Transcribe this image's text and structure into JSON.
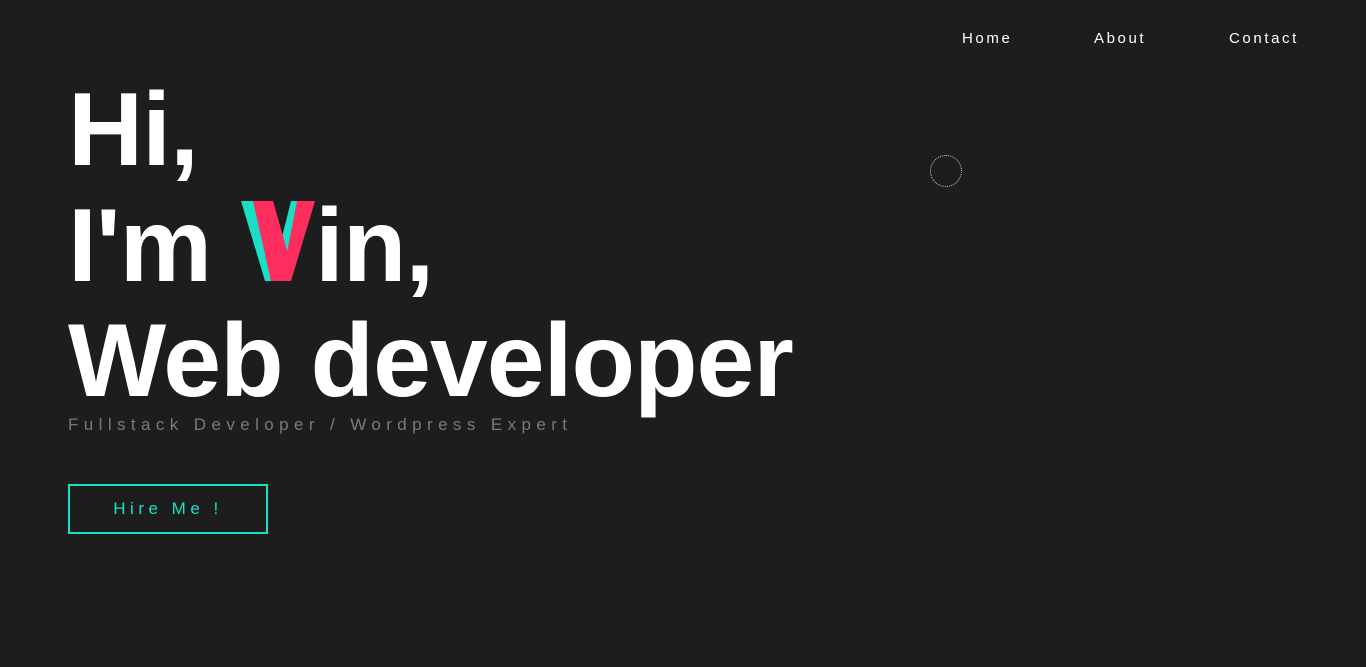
{
  "nav": {
    "items": [
      {
        "label": "Home"
      },
      {
        "label": "About"
      },
      {
        "label": "Contact"
      }
    ]
  },
  "hero": {
    "line1": "Hi,",
    "line2_prefix": "I'm ",
    "line2_logo_letter": "V",
    "line2_suffix": "in,",
    "line3": "Web developer",
    "subtitle": "Fullstack Developer / Wordpress Expert",
    "cta_label": "Hire Me !"
  },
  "colors": {
    "background": "#1d1d1d",
    "text": "#ffffff",
    "muted": "#7a7a7a",
    "accent_teal": "#17e0c6",
    "accent_pink": "#ff2d5e"
  },
  "icons": {
    "logo": "v-logo-icon",
    "cursor": "cursor-ring-icon"
  }
}
